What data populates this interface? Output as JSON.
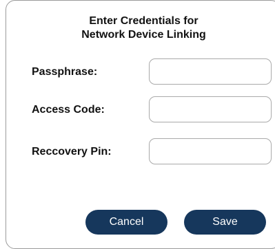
{
  "dialog": {
    "title_line1": "Enter Credentials for",
    "title_line2": "Network Device Linking",
    "fields": [
      {
        "label": "Passphrase:",
        "value": "",
        "placeholder": ""
      },
      {
        "label": "Access Code:",
        "value": "",
        "placeholder": ""
      },
      {
        "label": "Reccovery Pin:",
        "value": "",
        "placeholder": ""
      }
    ],
    "cancel_label": "Cancel",
    "save_label": "Save",
    "colors": {
      "button_bg": "#16375c",
      "button_text": "#ffffff",
      "border": "#9a9a9a"
    }
  }
}
